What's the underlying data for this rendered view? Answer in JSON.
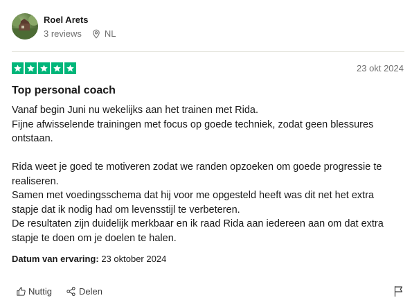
{
  "reviewer": {
    "name": "Roel Arets",
    "reviews": "3 reviews",
    "country": "NL"
  },
  "rating": {
    "stars": 5,
    "max": 5,
    "color": "#00b67a"
  },
  "review": {
    "date": "23 okt 2024",
    "title": "Top personal coach",
    "lines": [
      "Vanaf begin Juni nu wekelijks aan het trainen met Rida.",
      "Fijne afwisselende trainingen met focus op goede techniek, zodat geen blessures ontstaan.",
      "",
      "Rida weet je goed te motiveren zodat we randen opzoeken om goede progressie te realiseren.",
      "Samen met voedingsschema dat hij voor me opgesteld heeft was dit net het extra stapje dat ik nodig had om levensstijl te verbeteren.",
      "De resultaten zijn duidelijk merkbaar en ik raad Rida aan iedereen aan om dat extra stapje te doen om je doelen te halen."
    ],
    "experience_label": "Datum van ervaring:",
    "experience_date": "23 oktober 2024"
  },
  "actions": {
    "useful_label": "Nuttig",
    "share_label": "Delen"
  },
  "icons": {
    "location": "map-pin-icon",
    "useful": "thumbs-up-icon",
    "share": "share-icon",
    "report": "flag-icon",
    "star": "star-icon"
  }
}
